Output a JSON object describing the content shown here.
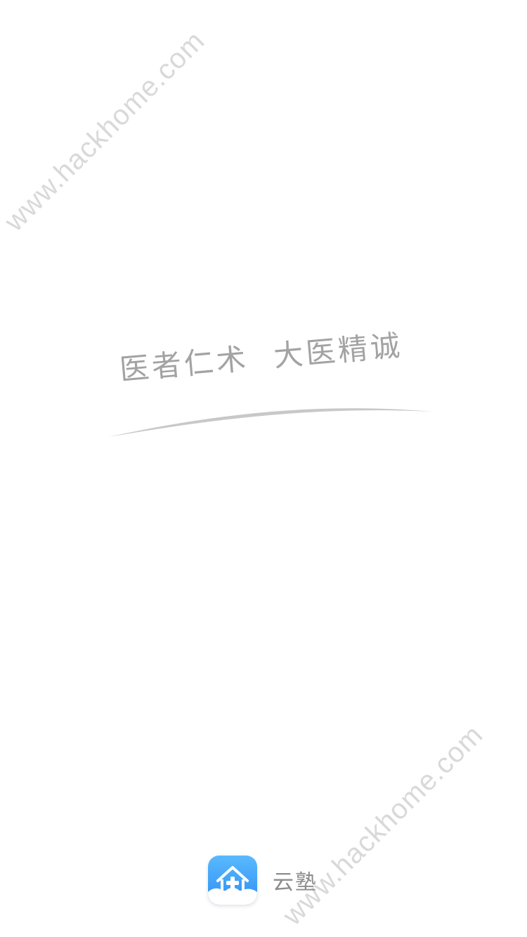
{
  "watermark": {
    "text_top": "www.hackhome.com",
    "text_bottom": "www.hackhome.com"
  },
  "slogan": {
    "part1": "医者仁术",
    "part2": "大医精诚"
  },
  "brand": {
    "icon": "house-cross-cloud-icon",
    "name": "云塾"
  },
  "colors": {
    "accent": "#2e8ff2",
    "accent_light": "#59b9ff",
    "slogan_text": "#a3a3a3",
    "brand_text": "#8c8c8c",
    "watermark": "#d9d9d9"
  }
}
